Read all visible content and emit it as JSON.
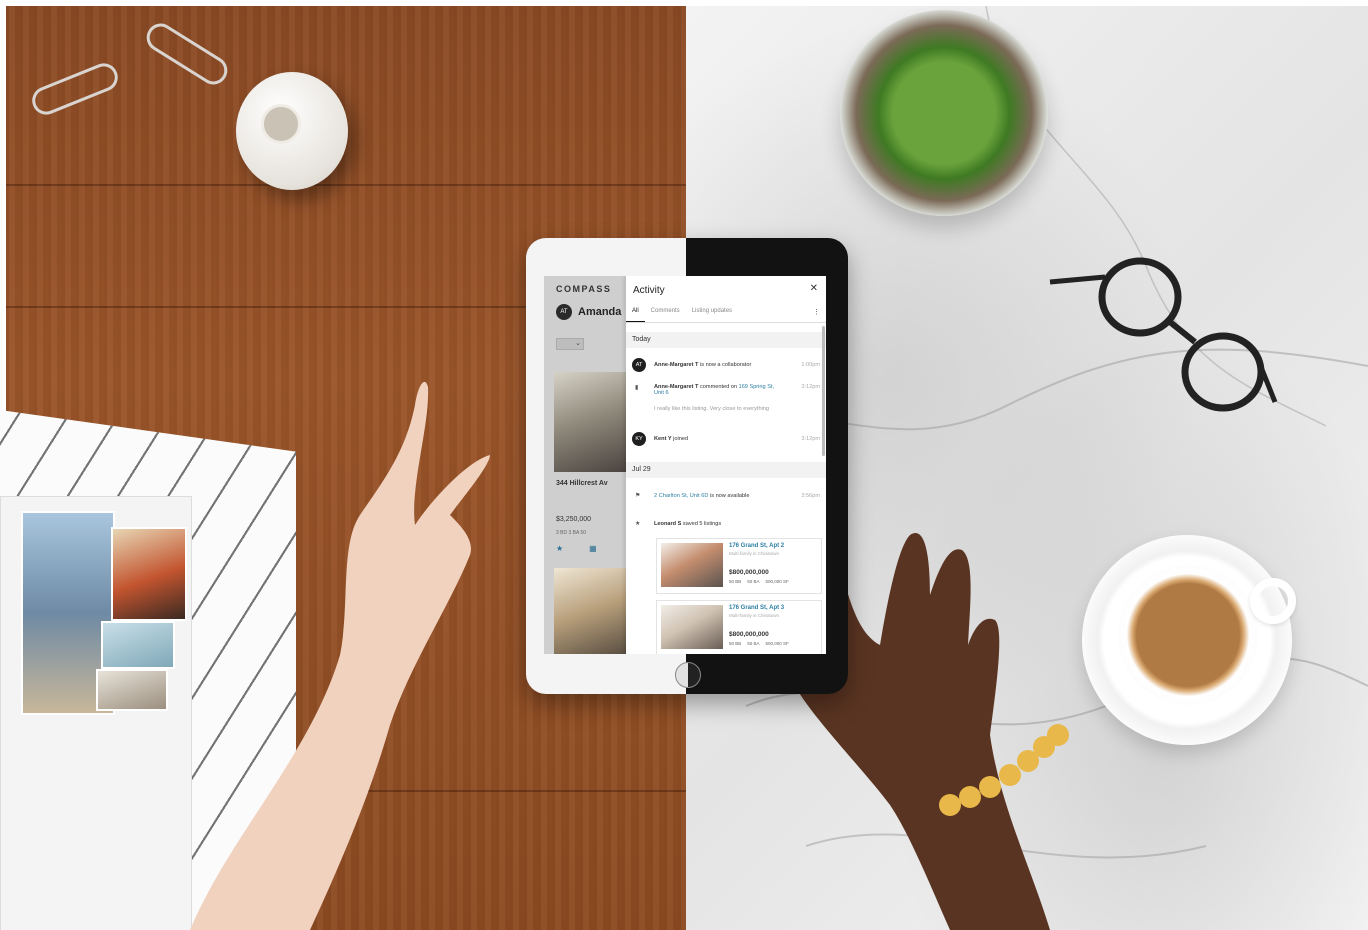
{
  "app": {
    "logo": "COMPASS",
    "user": {
      "initials": "AT",
      "name": "Amanda"
    },
    "view_toggle_icon": "chevron-down-icon",
    "listing": {
      "address": "344 Hillcrest Av",
      "price": "$3,250,000",
      "specs": "3 BD   3 BA   50",
      "actions": [
        "star-icon",
        "grid-icon"
      ]
    }
  },
  "activity": {
    "title": "Activity",
    "close": "✕",
    "tabs": [
      "All",
      "Comments",
      "Listing updates"
    ],
    "active_tab": "All",
    "more": "⋮",
    "sections": [
      {
        "label": "Today",
        "items": [
          {
            "avatar": "AT",
            "actor": "Anne-Margaret T",
            "text": " is now a collaborator",
            "time": "1:00pm"
          },
          {
            "icon": "comment-icon",
            "actor": "Anne-Margaret T",
            "text": " commented on ",
            "link": "169 Spring St, Unit 6",
            "quote": "I really like this listing. Very close to everything",
            "time": "3:12pm"
          },
          {
            "avatar": "KY",
            "actor": "Kent Y",
            "text": " joined",
            "time": "3:12pm"
          }
        ]
      },
      {
        "label": "Jul 29",
        "items": [
          {
            "icon": "flag-icon",
            "link": "2 Charlton St, Unit 6D",
            "text": " is now available",
            "time": "3:56pm"
          },
          {
            "icon": "star-icon",
            "actor": "Leonard S",
            "text": " saved 5 listings"
          }
        ]
      }
    ],
    "cards": [
      {
        "title": "176 Grand St, Apt 2",
        "subtitle": "Multi-family in Chinatown",
        "price": "$800,000,000",
        "specs": [
          "50 BB",
          "50 BA",
          "500,000 SF"
        ]
      },
      {
        "title": "176 Grand St, Apt 3",
        "subtitle": "Multi-family in Chinatown",
        "price": "$800,000,000",
        "specs": [
          "50 BB",
          "50 BA",
          "500,000 SF"
        ]
      }
    ]
  }
}
